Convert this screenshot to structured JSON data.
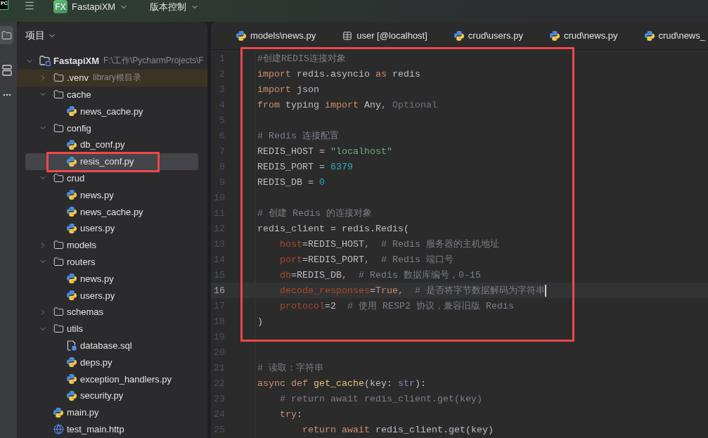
{
  "app_logo": "PC",
  "title_bar": {
    "project_badge": "FX",
    "project_name": "FastapiXM",
    "vcs_menu": "版本控制"
  },
  "tool_strip": [
    {
      "kind": "project",
      "selected": true
    },
    {
      "kind": "structure",
      "selected": false
    },
    {
      "kind": "more",
      "selected": false
    }
  ],
  "project_panel": {
    "title": "项目",
    "tree": [
      {
        "name": "FastapiXM",
        "hint": "F:\\工作\\PycharmProjects\\F",
        "kind": "project",
        "expanded": true,
        "selected": false,
        "boxed": false,
        "children": [
          {
            "name": ".venv",
            "hint": "library根目录",
            "kind": "library",
            "expanded": false,
            "selected": false,
            "boxed": false
          },
          {
            "name": "cache",
            "kind": "folder",
            "expanded": true,
            "selected": false,
            "boxed": false,
            "children": [
              {
                "name": "news_cache.py",
                "kind": "python",
                "selected": false,
                "boxed": false
              }
            ]
          },
          {
            "name": "config",
            "kind": "folder",
            "expanded": true,
            "selected": false,
            "boxed": false,
            "children": [
              {
                "name": "db_conf.py",
                "kind": "python",
                "selected": false,
                "boxed": false
              },
              {
                "name": "resis_conf.py",
                "kind": "python",
                "selected": true,
                "boxed": true
              }
            ]
          },
          {
            "name": "crud",
            "kind": "folder",
            "expanded": true,
            "selected": false,
            "boxed": false,
            "children": [
              {
                "name": "news.py",
                "kind": "python",
                "selected": false,
                "boxed": false
              },
              {
                "name": "news_cache.py",
                "kind": "python",
                "selected": false,
                "boxed": false
              },
              {
                "name": "users.py",
                "kind": "python",
                "selected": false,
                "boxed": false
              }
            ]
          },
          {
            "name": "models",
            "kind": "folder",
            "expanded": false,
            "selected": false,
            "boxed": false
          },
          {
            "name": "routers",
            "kind": "folder",
            "expanded": true,
            "selected": false,
            "boxed": false,
            "children": [
              {
                "name": "news.py",
                "kind": "python",
                "selected": false,
                "boxed": false
              },
              {
                "name": "users.py",
                "kind": "python",
                "selected": false,
                "boxed": false
              }
            ]
          },
          {
            "name": "schemas",
            "kind": "folder",
            "expanded": false,
            "selected": false,
            "boxed": false
          },
          {
            "name": "utils",
            "kind": "folder",
            "expanded": true,
            "selected": false,
            "boxed": false,
            "children": [
              {
                "name": "database.sql",
                "kind": "sql",
                "selected": false,
                "boxed": false
              },
              {
                "name": "deps.py",
                "kind": "python",
                "selected": false,
                "boxed": false
              },
              {
                "name": "exception_handlers.py",
                "kind": "python",
                "selected": false,
                "boxed": false
              },
              {
                "name": "security.py",
                "kind": "python",
                "selected": false,
                "boxed": false
              }
            ]
          },
          {
            "name": "main.py",
            "kind": "python",
            "selected": false,
            "boxed": false
          },
          {
            "name": "test_main.http",
            "kind": "http",
            "selected": false,
            "boxed": false
          }
        ]
      }
    ]
  },
  "editor": {
    "tabs": [
      {
        "label": "models\\news.py",
        "kind": "python",
        "selected": false
      },
      {
        "label": "user [@localhost]",
        "kind": "table",
        "selected": false
      },
      {
        "label": "crud\\users.py",
        "kind": "python",
        "selected": false
      },
      {
        "label": "crud\\news.py",
        "kind": "python",
        "selected": false
      },
      {
        "label": "crud\\news_",
        "kind": "python",
        "selected": false
      }
    ],
    "blocks": [
      {
        "boxed": true,
        "lines": [
          {
            "number": "1",
            "current": false,
            "tokens": [
              {
                "kind": "comment",
                "text": "#创建REDIS连接对象"
              }
            ]
          },
          {
            "number": "2",
            "current": false,
            "tokens": [
              {
                "kind": "keyword",
                "text": "import"
              },
              {
                "kind": "text",
                "text": " redis.asyncio "
              },
              {
                "kind": "keyword",
                "text": "as"
              },
              {
                "kind": "text",
                "text": " redis"
              }
            ]
          },
          {
            "number": "3",
            "current": false,
            "tokens": [
              {
                "kind": "keyword",
                "text": "import"
              },
              {
                "kind": "text",
                "text": " json"
              }
            ]
          },
          {
            "number": "4",
            "current": false,
            "tokens": [
              {
                "kind": "keyword",
                "text": "from"
              },
              {
                "kind": "text",
                "text": " typing "
              },
              {
                "kind": "keyword",
                "text": "import"
              },
              {
                "kind": "text",
                "text": " Any"
              },
              {
                "kind": "punctuation",
                "text": ", "
              },
              {
                "kind": "unused",
                "text": "Optional"
              }
            ]
          },
          {
            "number": "5",
            "current": false
          },
          {
            "number": "6",
            "current": false,
            "tokens": [
              {
                "kind": "comment",
                "text": "# Redis 连接配置"
              }
            ]
          },
          {
            "number": "7",
            "current": false,
            "tokens": [
              {
                "kind": "text",
                "text": "REDIS_HOST = "
              },
              {
                "kind": "string",
                "text": "\"localhost\""
              }
            ]
          },
          {
            "number": "8",
            "current": false,
            "tokens": [
              {
                "kind": "text",
                "text": "REDIS_PORT = "
              },
              {
                "kind": "number",
                "text": "6379"
              }
            ]
          },
          {
            "number": "9",
            "current": false,
            "tokens": [
              {
                "kind": "text",
                "text": "REDIS_DB = "
              },
              {
                "kind": "number",
                "text": "0"
              }
            ]
          },
          {
            "number": "10",
            "current": false
          },
          {
            "number": "11",
            "current": false,
            "tokens": [
              {
                "kind": "comment",
                "text": "# 创建 Redis 的连接对象"
              }
            ]
          },
          {
            "number": "12",
            "current": false,
            "tokens": [
              {
                "kind": "text",
                "text": "redis_client = redis.Redis("
              }
            ]
          },
          {
            "number": "13",
            "current": false,
            "tokens": [
              {
                "kind": "param",
                "text": "    host"
              },
              {
                "kind": "text",
                "text": "=REDIS_HOST"
              },
              {
                "kind": "punctuation",
                "text": ",  "
              },
              {
                "kind": "comment",
                "text": "# Redis 服务器的主机地址"
              }
            ]
          },
          {
            "number": "14",
            "current": false,
            "tokens": [
              {
                "kind": "param",
                "text": "    port"
              },
              {
                "kind": "text",
                "text": "=REDIS_PORT"
              },
              {
                "kind": "punctuation",
                "text": ",  "
              },
              {
                "kind": "comment",
                "text": "# Redis 端口号"
              }
            ]
          },
          {
            "number": "15",
            "current": false,
            "tokens": [
              {
                "kind": "param",
                "text": "    db"
              },
              {
                "kind": "text",
                "text": "=REDIS_DB"
              },
              {
                "kind": "punctuation",
                "text": ",  "
              },
              {
                "kind": "comment",
                "text": "# Redis 数据库编号，0-15"
              }
            ]
          },
          {
            "number": "16",
            "current": true,
            "tokens": [
              {
                "kind": "param",
                "text": "    decode_responses"
              },
              {
                "kind": "text",
                "text": "="
              },
              {
                "kind": "keyword",
                "text": "True"
              },
              {
                "kind": "punctuation",
                "text": ",  "
              },
              {
                "kind": "comment",
                "text": "# 是否将字节数据解码为字符串"
              }
            ]
          },
          {
            "number": "17",
            "current": false,
            "tokens": [
              {
                "kind": "param",
                "text": "    protocol"
              },
              {
                "kind": "text",
                "text": "=2  "
              },
              {
                "kind": "comment",
                "text": "# 使用 RESP2 协议，兼容旧版 Redis"
              }
            ]
          },
          {
            "number": "18",
            "current": false,
            "tokens": [
              {
                "kind": "text",
                "text": ")"
              }
            ]
          },
          {
            "number": "19",
            "current": false
          }
        ]
      },
      {
        "boxed": false,
        "lines": [
          {
            "number": "20",
            "current": false
          },
          {
            "number": "21",
            "current": false,
            "tokens": [
              {
                "kind": "comment",
                "text": "# 读取：字符串"
              }
            ]
          },
          {
            "number": "22",
            "current": false,
            "tokens": [
              {
                "kind": "keyword",
                "text": "async def "
              },
              {
                "kind": "function",
                "text": "get_cache"
              },
              {
                "kind": "text",
                "text": "(key: "
              },
              {
                "kind": "builtin",
                "text": "str"
              },
              {
                "kind": "text",
                "text": "):"
              }
            ]
          },
          {
            "number": "23",
            "current": false,
            "tokens": [
              {
                "kind": "comment",
                "text": "    # return await redis_client.get(key)"
              }
            ]
          },
          {
            "number": "24",
            "current": false,
            "tokens": [
              {
                "kind": "keyword",
                "text": "    try"
              },
              {
                "kind": "text",
                "text": ":"
              }
            ]
          },
          {
            "number": "25",
            "current": false,
            "tokens": [
              {
                "kind": "keyword",
                "text": "        return await"
              },
              {
                "kind": "text",
                "text": " redis_client.get(key)"
              }
            ]
          }
        ]
      }
    ]
  }
}
